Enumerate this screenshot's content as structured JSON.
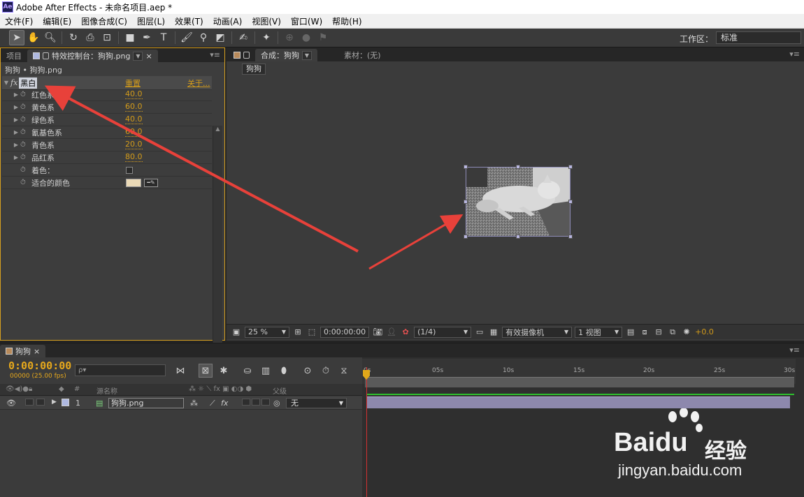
{
  "window": {
    "title": "Adobe After Effects - 未命名项目.aep *",
    "logo": "Ae"
  },
  "menu": [
    "文件(F)",
    "编辑(E)",
    "图像合成(C)",
    "图层(L)",
    "效果(T)",
    "动画(A)",
    "视图(V)",
    "窗口(W)",
    "帮助(H)"
  ],
  "workspace": {
    "label": "工作区：",
    "value": "标准"
  },
  "effects_panel": {
    "tab_project": "项目",
    "tab_effects": "特效控制台：狗狗.png",
    "breadcrumb": "狗狗 • 狗狗.png",
    "effect": {
      "fx_label": "fx",
      "name": "黑白",
      "reset": "重置",
      "about": "关于..."
    },
    "params": [
      {
        "name": "红色系",
        "value": "40.0"
      },
      {
        "name": "黄色系",
        "value": "60.0"
      },
      {
        "name": "绿色系",
        "value": "40.0"
      },
      {
        "name": "氰基色系",
        "value": "60.0"
      },
      {
        "name": "青色系",
        "value": "20.0"
      },
      {
        "name": "品红系",
        "value": "80.0"
      }
    ],
    "tint_label": "着色：",
    "tint_color_label": "适合的颜色",
    "tint_color": "#ead9b6"
  },
  "comp_panel": {
    "tab_comp": "合成：狗狗",
    "tab_footage": "素材：(无)",
    "comp_chip": "狗狗",
    "zoom": "25 %",
    "timecode": "0:00:00:00",
    "resolution": "(1/4)",
    "camera": "有效摄像机",
    "views": "1 视图",
    "exposure": "+0.0"
  },
  "timeline": {
    "tab": "狗狗",
    "time": "0:00:00:00",
    "fps": "00000 (25.00 fps)",
    "search_placeholder": "ρ▾",
    "col_num": "#",
    "col_source": "源名称",
    "col_parent": "父级",
    "layer": {
      "index": "1",
      "name": "狗狗.png",
      "parent": "无"
    },
    "ruler": [
      "0s",
      "05s",
      "10s",
      "15s",
      "20s",
      "25s",
      "30s"
    ]
  },
  "watermark": {
    "brand": "Bai",
    "brand2": "du",
    "cn": "经验",
    "url": "jingyan.baidu.com"
  },
  "colors": {
    "accent": "#d39b1a",
    "panel_border": "#d8a020",
    "arrow": "#e8413a",
    "layer_bar": "#8d88ad",
    "playhead": "#d43030"
  }
}
